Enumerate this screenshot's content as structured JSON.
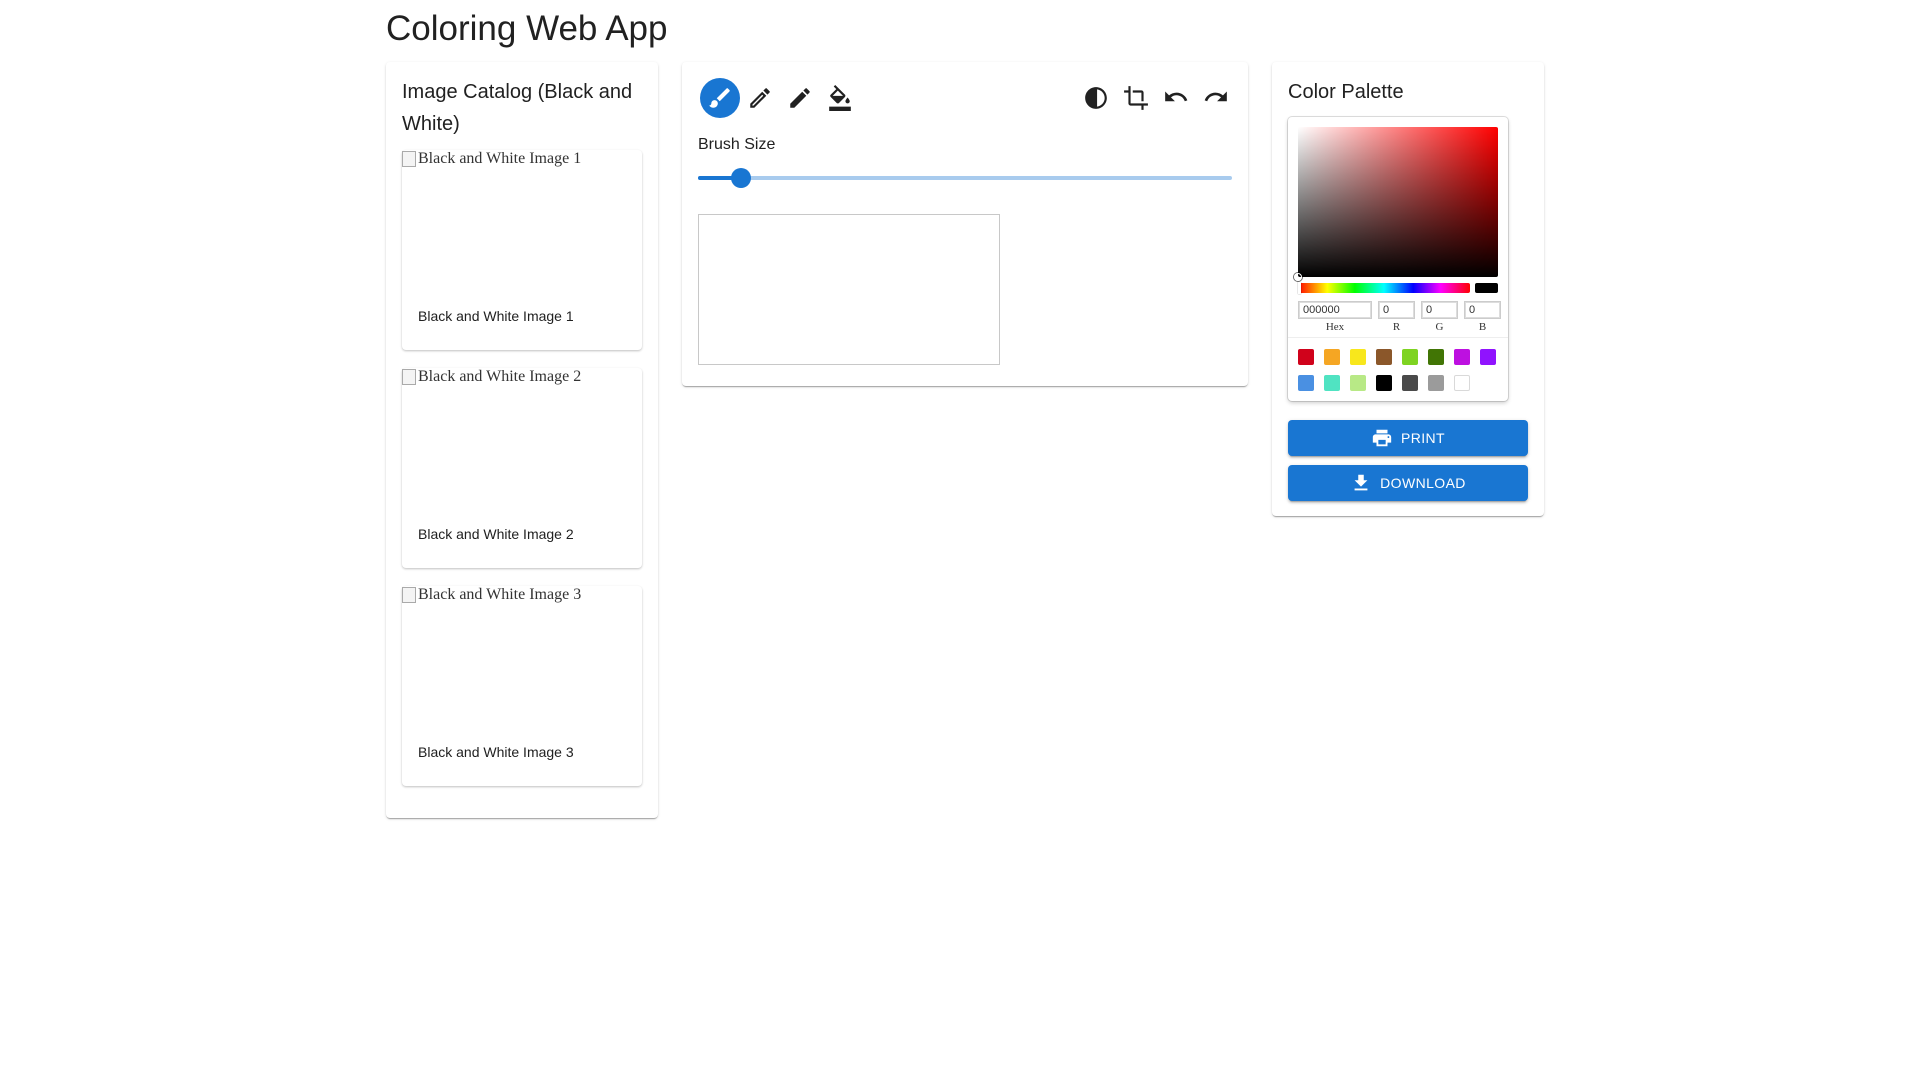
{
  "app": {
    "title": "Coloring Web App"
  },
  "catalog": {
    "title": "Image Catalog (Black and White)",
    "items": [
      {
        "alt": "Black and White Image 1",
        "caption": "Black and White Image 1"
      },
      {
        "alt": "Black and White Image 2",
        "caption": "Black and White Image 2"
      },
      {
        "alt": "Black and White Image 3",
        "caption": "Black and White Image 3"
      }
    ]
  },
  "editor": {
    "tools": [
      {
        "name": "brush-tool",
        "icon": "brush-icon",
        "active": true
      },
      {
        "name": "pencil-tool",
        "icon": "pencil-outline-icon",
        "active": false
      },
      {
        "name": "pen-tool",
        "icon": "pencil-icon",
        "active": false
      },
      {
        "name": "fill-tool",
        "icon": "paint-bucket-icon",
        "active": false
      }
    ],
    "actions": [
      {
        "name": "contrast-button",
        "icon": "contrast-icon"
      },
      {
        "name": "crop-button",
        "icon": "crop-icon"
      },
      {
        "name": "undo-button",
        "icon": "undo-icon"
      },
      {
        "name": "redo-button",
        "icon": "redo-icon"
      }
    ],
    "brush_size": {
      "label": "Brush Size",
      "fraction": 0.08
    }
  },
  "palette": {
    "title": "Color Palette",
    "current_color": "#000000",
    "hex": {
      "label": "Hex",
      "value": "000000"
    },
    "r": {
      "label": "R",
      "value": "0"
    },
    "g": {
      "label": "G",
      "value": "0"
    },
    "b": {
      "label": "B",
      "value": "0"
    },
    "swatches": [
      "#D0021B",
      "#F5A623",
      "#F8E71C",
      "#8B572A",
      "#7ED321",
      "#417505",
      "#BD10E0",
      "#9013FE",
      "#4A90E2",
      "#50E3C2",
      "#B8E986",
      "#000000",
      "#4A4A4A",
      "#9B9B9B",
      "#FFFFFF"
    ],
    "print_label": "Print",
    "download_label": "Download",
    "accent": "#1976d2"
  }
}
